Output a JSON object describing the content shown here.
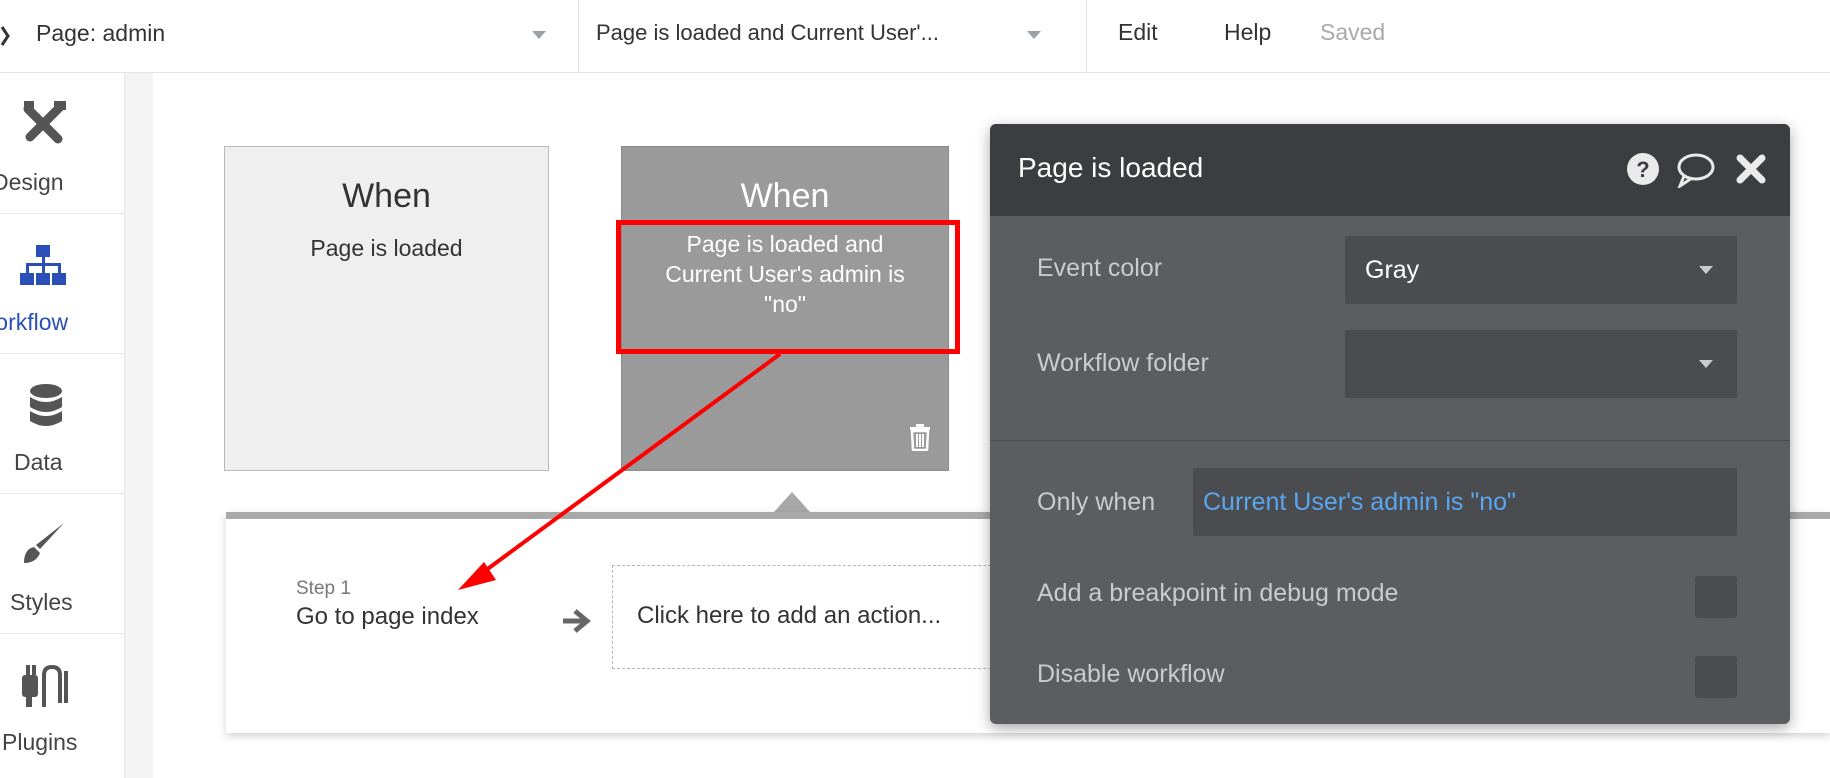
{
  "topbar": {
    "page_selector": "Page: admin",
    "workflow_selector": "Page is loaded and Current User'...",
    "menu_edit": "Edit",
    "menu_help": "Help",
    "save_status": "Saved"
  },
  "sidebar": {
    "items": [
      {
        "label": "Design",
        "icon": "design-icon"
      },
      {
        "label": "Workflow",
        "icon": "workflow-icon"
      },
      {
        "label": "Data",
        "icon": "database-icon"
      },
      {
        "label": "Styles",
        "icon": "brush-icon"
      },
      {
        "label": "Plugins",
        "icon": "plug-icon"
      }
    ]
  },
  "events": [
    {
      "when": "When",
      "description": "Page is loaded"
    },
    {
      "when": "When",
      "description": "Page is loaded and Current User's admin is \"no\""
    }
  ],
  "actions": {
    "step_label": "Step 1",
    "step_name": "Go to page index",
    "add_action": "Click here to add an action..."
  },
  "property_editor": {
    "title": "Page is loaded",
    "event_color_label": "Event color",
    "event_color_value": "Gray",
    "workflow_folder_label": "Workflow folder",
    "workflow_folder_value": "",
    "only_when_label": "Only when",
    "only_when_value": "Current User's admin is \"no\"",
    "breakpoint_label": "Add a breakpoint in debug mode",
    "disable_label": "Disable workflow"
  },
  "colors": {
    "sidebar_active": "#2b4fb8",
    "highlight": "#ff0000",
    "expression_blue": "#5aa7f0",
    "panel_dark": "#3b3d40",
    "panel_body": "#5b5d60"
  }
}
